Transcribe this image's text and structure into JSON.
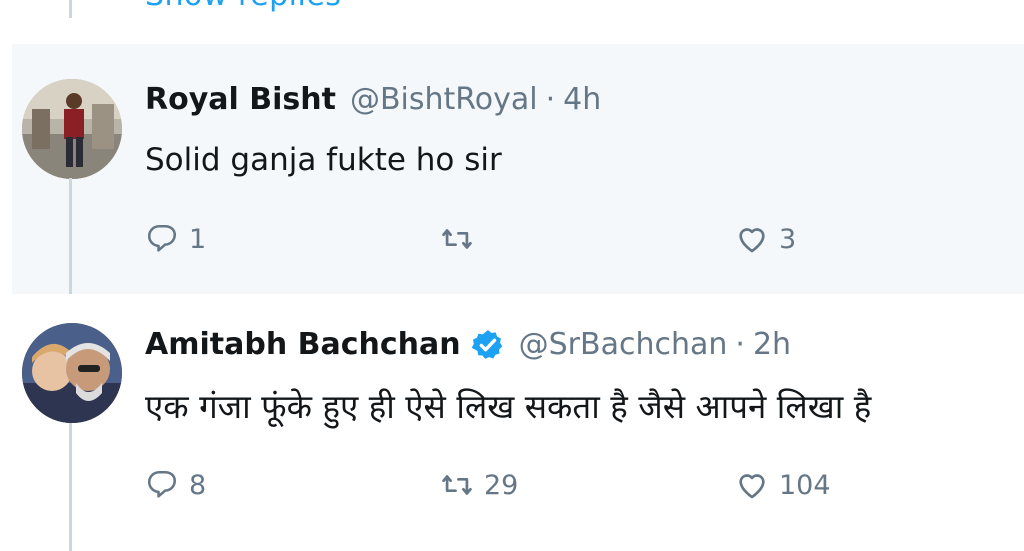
{
  "show_replies_label": "Show replies",
  "tweets": [
    {
      "name": "Royal Bisht",
      "handle": "@BishtRoyal",
      "separator": "·",
      "time": "4h",
      "text": "Solid ganja fukte ho sir",
      "verified": false,
      "replies": "1",
      "retweets": "",
      "likes": "3"
    },
    {
      "name": "Amitabh Bachchan",
      "handle": "@SrBachchan",
      "separator": "·",
      "time": "2h",
      "text": "एक गंजा फूंके हुए ही ऐसे लिख सकता है जैसे आपने लिखा है",
      "verified": true,
      "replies": "8",
      "retweets": "29",
      "likes": "104"
    }
  ],
  "colors": {
    "accent": "#1da1f2",
    "muted": "#657786",
    "thread_line": "#ccd6dd",
    "highlight_bg": "#f5f8fa"
  },
  "icons": [
    "reply-icon",
    "retweet-icon",
    "like-icon",
    "verified-badge-icon"
  ]
}
